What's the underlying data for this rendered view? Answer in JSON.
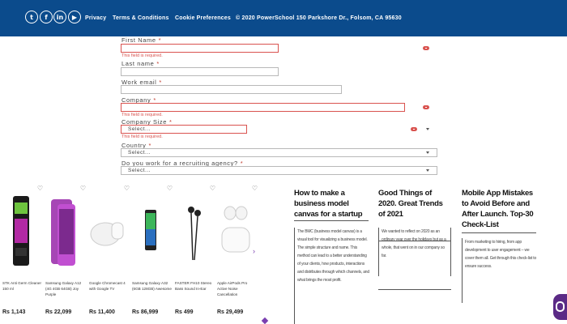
{
  "header": {
    "social": [
      {
        "name": "twitter-icon",
        "glyph": "t"
      },
      {
        "name": "facebook-icon",
        "glyph": "f"
      },
      {
        "name": "linkedin-icon",
        "glyph": "in"
      },
      {
        "name": "youtube-icon",
        "glyph": "▶"
      }
    ],
    "links": {
      "privacy": "Privacy",
      "terms": "Terms & Conditions",
      "cookies": "Cookie Preferences",
      "address": "© 2020 PowerSchool 150 Parkshore Dr., Folsom, CA 95630"
    },
    "color": "#0b4b8c"
  },
  "form": {
    "required_mark": "*",
    "first_name": {
      "label": "First Name",
      "error": "This field is required."
    },
    "last_name": {
      "label": "Last name"
    },
    "work_email": {
      "label": "Work email"
    },
    "company": {
      "label": "Company",
      "error": "This field is required."
    },
    "company_size": {
      "label": "Company Size",
      "value": "Select...",
      "error": "This field is required."
    },
    "country": {
      "label": "Country",
      "value": "Select..."
    },
    "recruiting": {
      "label": "Do you work for a recruiting agency?",
      "value": "Select..."
    }
  },
  "products": [
    {
      "name": "STK Anti Germ Cleaner 150 ml",
      "price": "Rs 1,143"
    },
    {
      "name": "Samsung Galaxy A12 (4G 4GB 64GB) Joy Purple",
      "price": "Rs 22,099"
    },
    {
      "name": "Google Chromecast 4 with Google TV",
      "price": "Rs 11,400"
    },
    {
      "name": "Samsung Galaxy A32 (6GB 128GB) Awesome",
      "price": "Rs 86,999"
    },
    {
      "name": "FASTER FH10 Stereo Bass Sound In-Ear",
      "price": "Rs 499"
    },
    {
      "name": "Apple AirPods Pro Active Noise Cancellation",
      "price": "Rs 29,499"
    }
  ],
  "blog": [
    {
      "title": "How to make a business model canvas for a startup",
      "excerpt": "The BMC (business model canvas) is a visual tool for visualizing a business model. The simple structure and name. This method can lead to a better understanding of your clients, how products, interactions and distributes through which channels, and what brings the most profit."
    },
    {
      "title": "Good Things of 2020. Great Trends of 2021",
      "excerpt": "We wanted to reflect on 2020 as an ordinary year over the holidays but as a whole, that went on in our company so far."
    },
    {
      "title": "Mobile App Mistakes to Avoid Before and After Launch. Top-30 Check-List",
      "excerpt": "From marketing to hiring, from app development to user engagement – we cover them all. Get through this check-list to ensure success."
    }
  ]
}
